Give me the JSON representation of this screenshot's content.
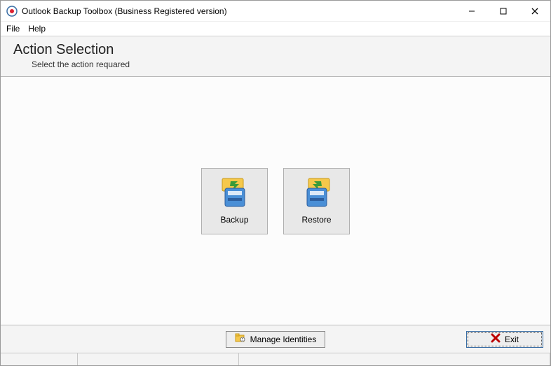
{
  "window": {
    "title": "Outlook Backup Toolbox (Business Registered version)"
  },
  "menu": {
    "file": "File",
    "help": "Help"
  },
  "header": {
    "title": "Action Selection",
    "subtitle": "Select the action requared"
  },
  "actions": {
    "backup": "Backup",
    "restore": "Restore"
  },
  "buttons": {
    "manage": "Manage Identities",
    "exit": "Exit"
  }
}
